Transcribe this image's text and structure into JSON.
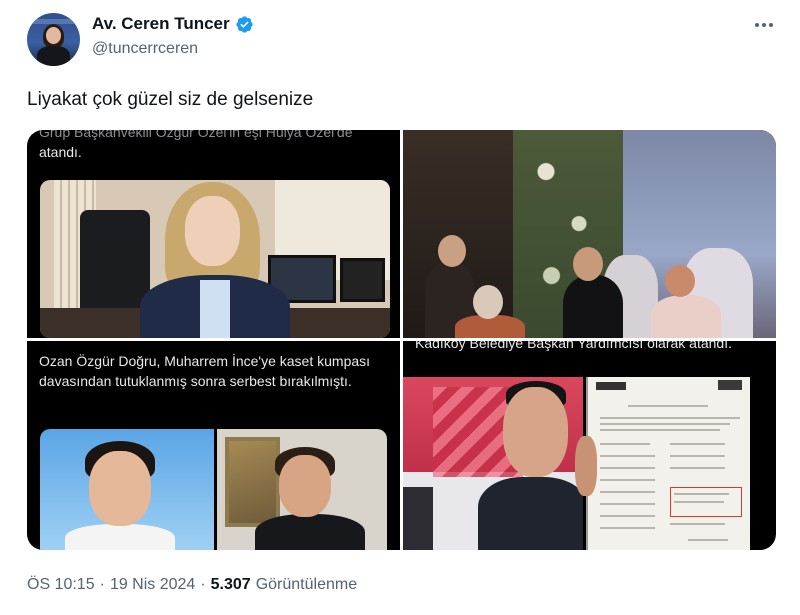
{
  "author": {
    "display_name": "Av. Ceren Tuncer",
    "handle": "@tuncerrceren",
    "verified": true,
    "verified_color": "#1d9bf0"
  },
  "tweet": {
    "text": "Liyakat çok güzel siz de gelsenize"
  },
  "media": {
    "image_count": 4,
    "images": [
      {
        "caption_top": "Grup Başkanvekili Özgür Özel'in eşi Hülya Özel'de",
        "caption": "atandı."
      },
      {
        "caption": ""
      },
      {
        "caption": "Ozan Özgür Doğru, Muharrem İnce'ye kaset kumpası davasından tutuklanmış sonra serbest bırakılmıştı."
      },
      {
        "caption_top": "Kadıköy Belediye Başkan Yardımcısı olarak atandı."
      }
    ]
  },
  "meta": {
    "time": "ÖS 10:15",
    "separator": "·",
    "date": "19 Nis 2024",
    "views_count": "5.307",
    "views_label": "Görüntülenme"
  },
  "icons": {
    "more": "more-horizontal-icon",
    "verified": "verified-badge-icon"
  },
  "colors": {
    "text": "#0f1419",
    "secondary": "#536471",
    "media_bg": "#000000"
  }
}
